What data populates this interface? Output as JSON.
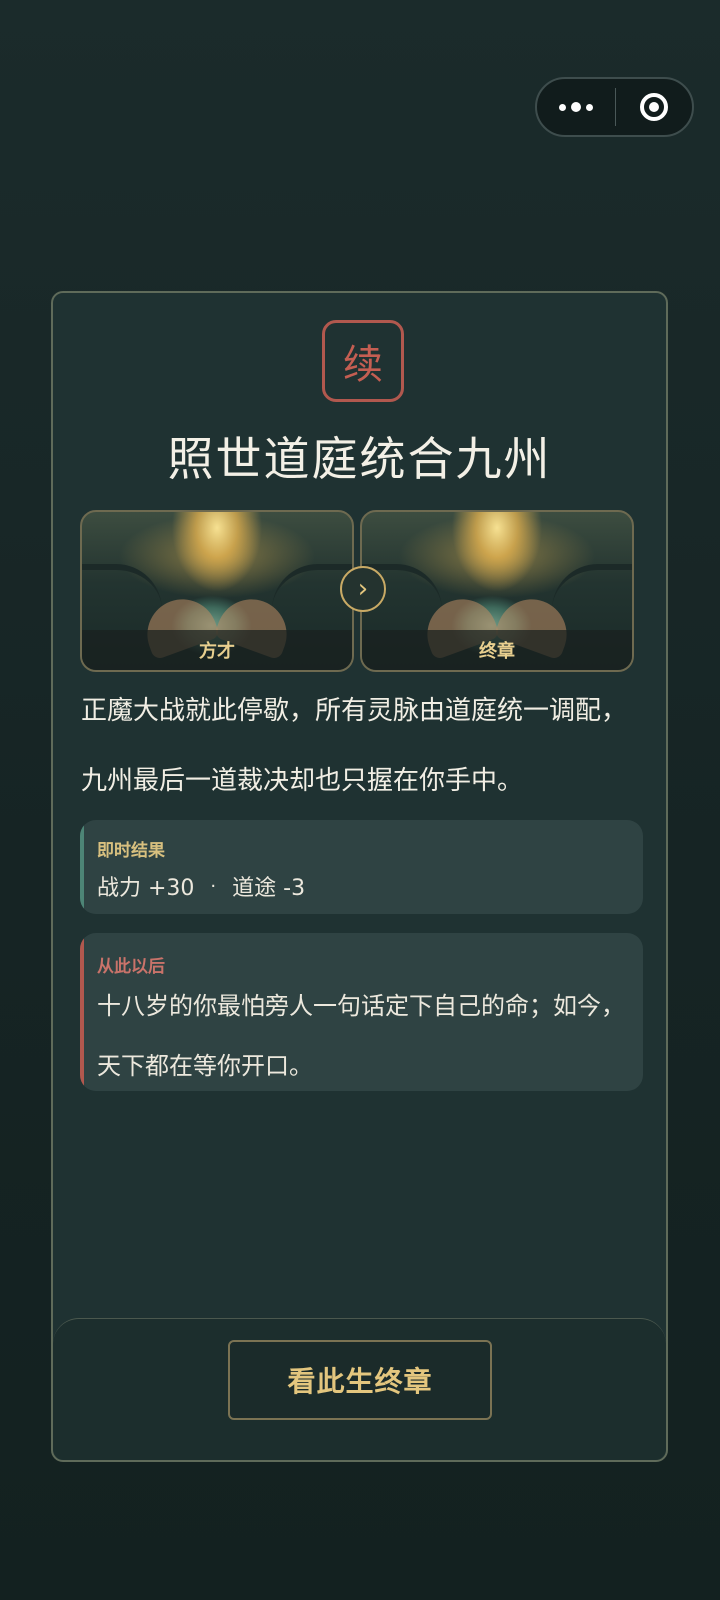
{
  "capsule": {
    "more_icon": "more-dots-icon",
    "close_icon": "target-circle-icon"
  },
  "card": {
    "seal_char": "续",
    "title": "照世道庭统合九州",
    "images": [
      {
        "caption": "方才"
      },
      {
        "caption": "终章"
      }
    ],
    "arrow_glyph": "›",
    "narrative": "正魔大战就此停歇，所有灵脉由道庭统一调配，九州最后一道裁决却也只握在你手中。",
    "immediate": {
      "label": "即时结果",
      "stat_1": "战力 +30",
      "bullet": "·",
      "stat_2": "道途 -3"
    },
    "after": {
      "label": "从此以后",
      "text": "十八岁的你最怕旁人一句话定下自己的命；如今，天下都在等你开口。"
    },
    "footer_button": "看此生终章"
  },
  "colors": {
    "background": "#1b2b2b",
    "card": "#1f3232",
    "gold": "#e3c67e",
    "seal_red": "#c45e52",
    "box": "#2f4343",
    "teal_accent": "#4d8576"
  }
}
